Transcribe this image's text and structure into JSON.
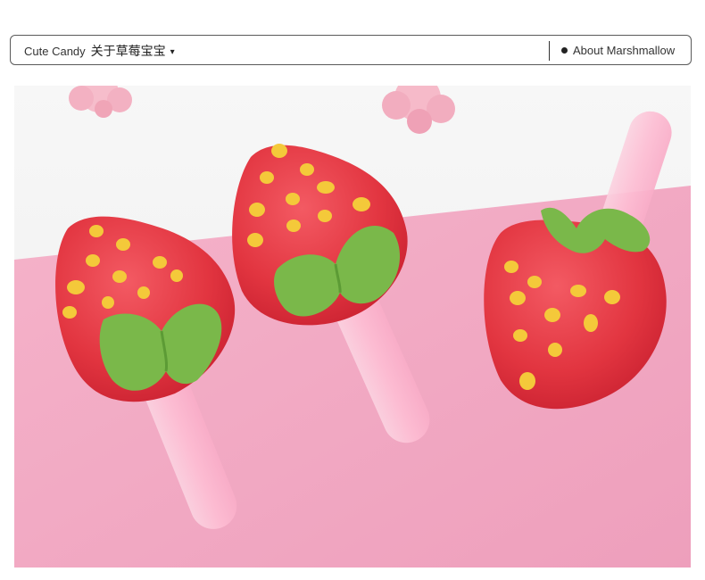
{
  "header": {
    "brand": "Cute Candy",
    "menu_label": "关于草莓宝宝",
    "menu_caret": "▾",
    "about_label": "About Marshmallow"
  },
  "photo": {
    "subject": "three strawberry-shaped gummy candies on pink sticks",
    "colors": {
      "background_pink": "#f2b2c9",
      "wall": "#f6f6f6",
      "candy_red": "#e02f3c",
      "leaf_green": "#75b54a",
      "seed_yellow": "#f2c93a",
      "stick_pink": "#fbc3d7"
    }
  }
}
